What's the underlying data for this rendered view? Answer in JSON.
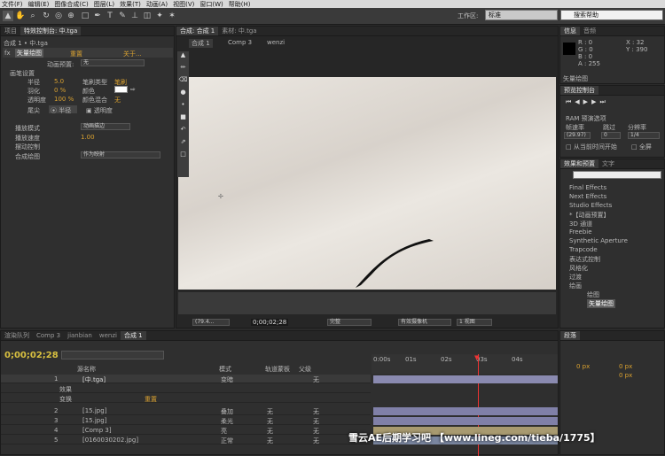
{
  "menu": {
    "items": [
      "文件(F)",
      "编辑(E)",
      "图像合成(C)",
      "图层(L)",
      "效果(T)",
      "动画(A)",
      "视图(V)",
      "窗口(W)",
      "帮助(H)"
    ]
  },
  "toolbar": {
    "workspace_label": "工作区:",
    "workspace_value": "标准",
    "search_placeholder": "搜索帮助"
  },
  "project": {
    "tab_project": "项目",
    "tab_effects": "特效控制台: 中.tga",
    "breadcrumb": "合成 1 • 中.tga",
    "effect_name": "矢量绘图",
    "reset": "重置",
    "about": "关于...",
    "preset_label": "动画预置:",
    "preset_value": "无",
    "brush_settings": "画笔设置",
    "radius": "半径",
    "radius_val": "5.0",
    "feather": "羽化",
    "feather_val": "0 %",
    "opacity": "透明度",
    "opacity_val": "100 %",
    "brush_type": "笔刷类型",
    "brush_type_val": "笔刷",
    "color": "颜色",
    "color_mix": "颜色混合",
    "color_mix_val": "无",
    "tip": "尾尖",
    "tip_radius": "半径",
    "tip_opacity": "透明度",
    "playback_mode": "播放模式",
    "playback_mode_val": "动画描边",
    "playback_speed": "播放速度",
    "playback_speed_val": "1.00",
    "wiggle": "摆动控制",
    "composite": "合成绘图",
    "composite_val": "作为映射"
  },
  "comp": {
    "tab": "合成: 合成 1",
    "tab2": "素材: 中.tga",
    "crumb1": "合成 1",
    "crumb2": "Comp 3",
    "crumb3": "wenzi",
    "zoom": "(79.4...",
    "time": "0;00;02;28",
    "res": "完整",
    "camera": "有效摄像机",
    "views": "1 视图"
  },
  "info": {
    "tab_info": "信息",
    "tab_audio": "音频",
    "r": "R : 0",
    "g": "G : 0",
    "b": "B : 0",
    "a": "A : 255",
    "x": "X : 32",
    "y": "Y : 390",
    "label": "矢量绘图"
  },
  "preview": {
    "tab": "预览控制台",
    "ram": "RAM 预演选项",
    "fps_label": "帧速率",
    "skip_label": "跳过",
    "res_label": "分辨率",
    "fps": "(29.97)",
    "skip": "0",
    "res": "1/4",
    "from_current": "从当前时间开始",
    "fullscreen": "全屏"
  },
  "effects": {
    "tab": "效果和预置",
    "tab2": "文字",
    "items": [
      "Final Effects",
      "Next Effects",
      "Studio Effects",
      "*【动画预置】",
      "3D 通道",
      "Freebie",
      "Synthetic Aperture",
      "Trapcode",
      "表达式控制",
      "风格化",
      "过渡",
      "绘画"
    ],
    "sub1": "绘图",
    "sub2": "矢量绘图"
  },
  "timeline": {
    "tabs": [
      "渲染队列",
      "Comp 3",
      "jianbian",
      "wenzi",
      "合成 1"
    ],
    "time": "0;00;02;28",
    "col_name": "源名称",
    "col_mode": "模式",
    "col_track": "轨道蒙板",
    "col_parent": "父级",
    "ruler": [
      "0:00s",
      "01s",
      "02s",
      "03s",
      "04s"
    ],
    "layers": [
      {
        "num": "1",
        "name": "[中.tga]",
        "mode": "变暗",
        "track": "",
        "parent": "无"
      },
      {
        "num": "",
        "name": "效果",
        "mode": "",
        "track": "",
        "parent": ""
      },
      {
        "num": "",
        "name": "变换",
        "mode": "重置",
        "track": "",
        "parent": ""
      },
      {
        "num": "2",
        "name": "[15.jpg]",
        "mode": "叠加",
        "track": "无",
        "parent": "无"
      },
      {
        "num": "3",
        "name": "[15.jpg]",
        "mode": "柔光",
        "track": "无",
        "parent": "无"
      },
      {
        "num": "4",
        "name": "[Comp 3]",
        "mode": "亮",
        "track": "无",
        "parent": "无"
      },
      {
        "num": "5",
        "name": "[0160030202.jpg]",
        "mode": "正常",
        "track": "无",
        "parent": "无"
      }
    ]
  },
  "paragraph": {
    "tab": "段落",
    "px": "0 px"
  },
  "watermark": "雪云AE后期学习吧 【www.lineg.com/tieba/1775】"
}
